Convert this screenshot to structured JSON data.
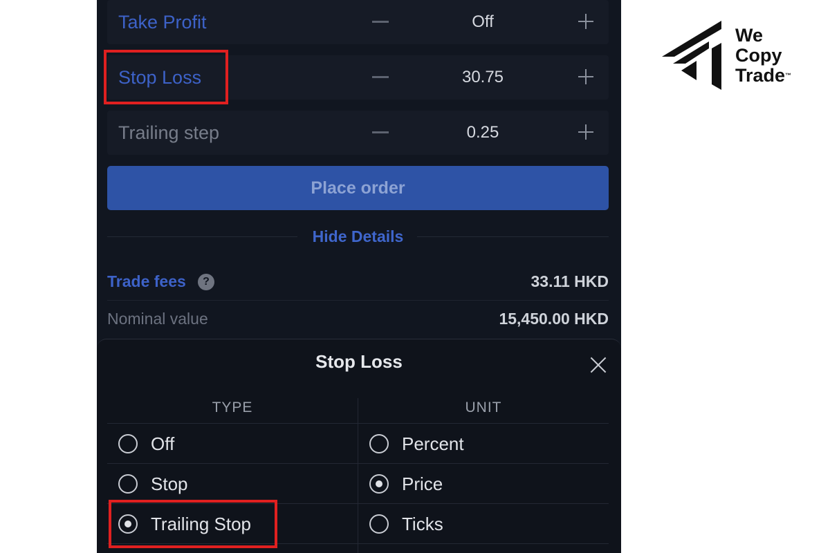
{
  "order_form": {
    "rows": [
      {
        "label": "Take Profit",
        "value": "Off"
      },
      {
        "label": "Stop Loss",
        "value": "30.75"
      },
      {
        "label": "Trailing step",
        "value": "0.25"
      }
    ],
    "place_order_label": "Place order",
    "hide_details_label": "Hide Details",
    "fees_label": "Trade fees",
    "fees_value": "33.11 HKD",
    "nominal_label": "Nominal value",
    "nominal_value": "15,450.00 HKD",
    "help_glyph": "?"
  },
  "stop_loss_sheet": {
    "title": "Stop Loss",
    "type_header": "TYPE",
    "unit_header": "UNIT",
    "type_options": [
      {
        "label": "Off",
        "selected": false
      },
      {
        "label": "Stop",
        "selected": false
      },
      {
        "label": "Trailing Stop",
        "selected": true
      }
    ],
    "unit_options": [
      {
        "label": "Percent",
        "selected": false
      },
      {
        "label": "Price",
        "selected": true
      },
      {
        "label": "Ticks",
        "selected": false
      }
    ]
  },
  "brand": {
    "line1": "We",
    "line2": "Copy",
    "line3": "Trade",
    "trademark": "™"
  },
  "colors": {
    "panel_bg": "#111620",
    "accent_blue": "#3d62c8",
    "button_blue": "#2e53a6",
    "highlight_red": "#e02020"
  },
  "icons": {
    "minus": "minus-icon",
    "plus": "plus-icon",
    "close": "close-icon",
    "help": "help-icon",
    "radio": "radio-icon",
    "logo": "wecopytrade-logo"
  }
}
